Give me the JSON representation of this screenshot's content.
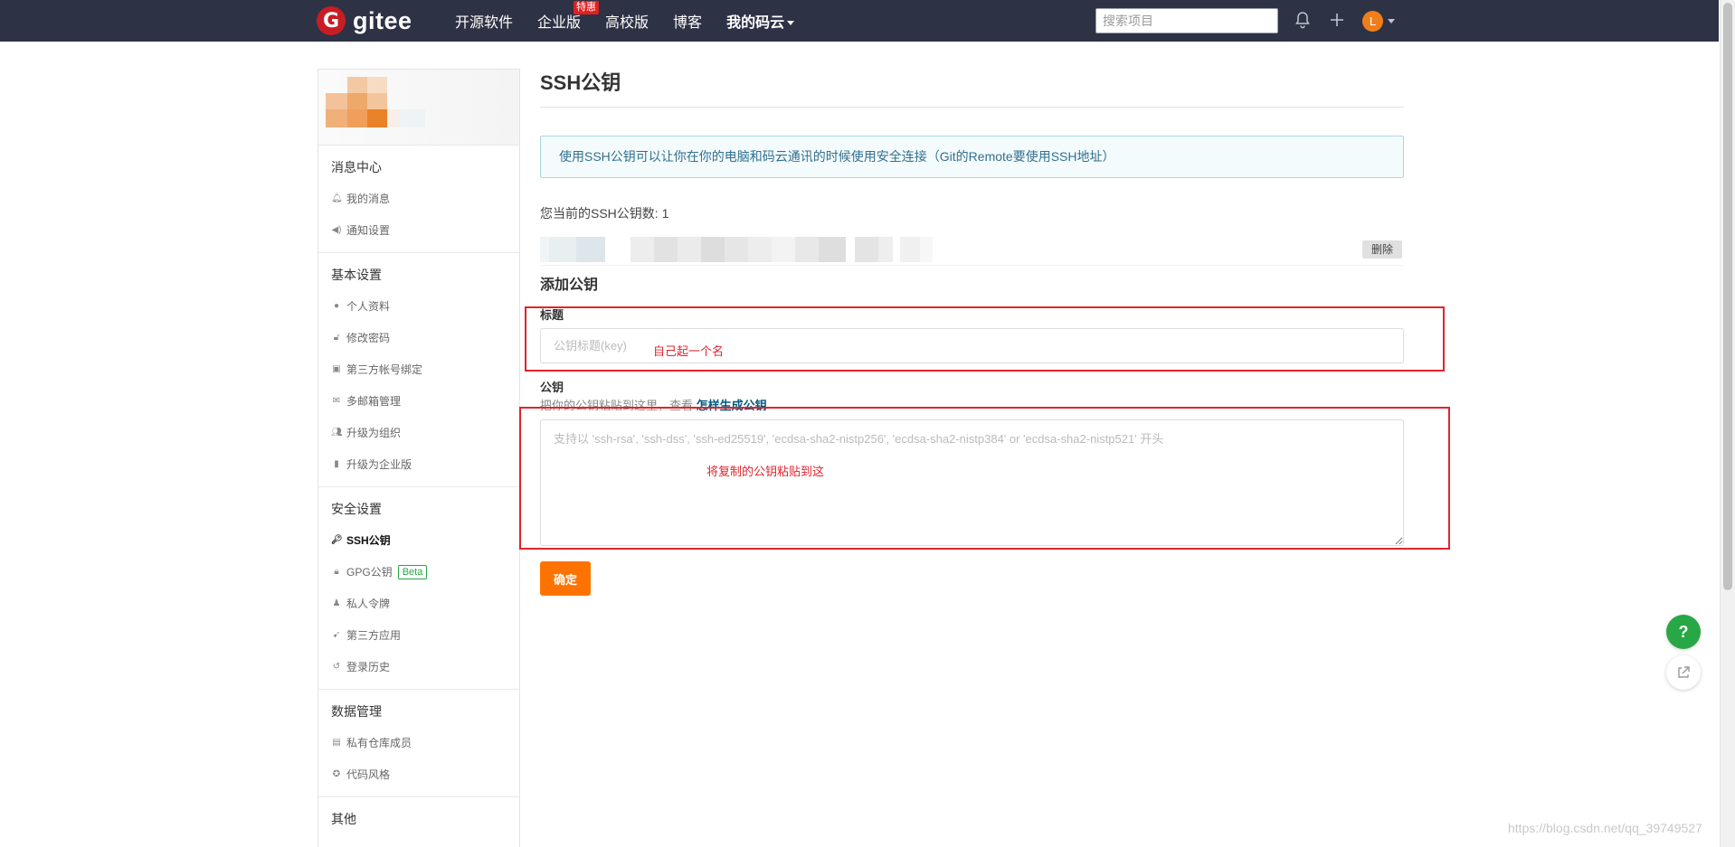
{
  "header": {
    "logo_mark": "G",
    "logo_text": "gitee",
    "nav": [
      {
        "label": "开源软件"
      },
      {
        "label": "企业版",
        "badge": "特惠"
      },
      {
        "label": "高校版"
      },
      {
        "label": "博客"
      },
      {
        "label": "我的码云"
      }
    ],
    "search_placeholder": "搜索项目",
    "avatar_letter": "L"
  },
  "sidebar": {
    "sections": [
      {
        "title": "消息中心",
        "items": [
          {
            "icon": "bell-icon",
            "label": "我的消息"
          },
          {
            "icon": "speaker-icon",
            "label": "通知设置"
          }
        ]
      },
      {
        "title": "基本设置",
        "items": [
          {
            "icon": "user-icon",
            "label": "个人资料"
          },
          {
            "icon": "unlock-icon",
            "label": "修改密码"
          },
          {
            "icon": "id-card-icon",
            "label": "第三方帐号绑定"
          },
          {
            "icon": "mail-icon",
            "label": "多邮箱管理"
          },
          {
            "icon": "users-icon",
            "label": "升级为组织"
          },
          {
            "icon": "building-icon",
            "label": "升级为企业版"
          }
        ]
      },
      {
        "title": "安全设置",
        "items": [
          {
            "icon": "key-icon",
            "label": "SSH公钥",
            "active": true
          },
          {
            "icon": "lock-icon",
            "label": "GPG公钥",
            "badge": "Beta"
          },
          {
            "icon": "token-icon",
            "label": "私人令牌"
          },
          {
            "icon": "rocket-icon",
            "label": "第三方应用"
          },
          {
            "icon": "history-icon",
            "label": "登录历史"
          }
        ]
      },
      {
        "title": "数据管理",
        "items": [
          {
            "icon": "repo-member-icon",
            "label": "私有仓库成员"
          },
          {
            "icon": "palette-icon",
            "label": "代码风格"
          }
        ]
      },
      {
        "title": "其他",
        "items": []
      }
    ]
  },
  "main": {
    "title": "SSH公钥",
    "info": "使用SSH公钥可以让你在你的电脑和码云通讯的时候使用安全连接（Git的Remote要使用SSH地址）",
    "count_text": "您当前的SSH公钥数: 1",
    "delete_label": "删除",
    "add_title": "添加公钥",
    "title_label": "标题",
    "title_placeholder": "公钥标题(key)",
    "key_label": "公钥",
    "key_hint": "把你的公钥粘贴到这里，查看 ",
    "key_hint_link": "怎样生成公钥",
    "key_placeholder": "支持以 'ssh-rsa', 'ssh-dss', 'ssh-ed25519', 'ecdsa-sha2-nistp256', 'ecdsa-sha2-nistp384' or 'ecdsa-sha2-nistp521' 开头",
    "submit_label": "确定"
  },
  "annotations": {
    "title_note": "自己起一个名",
    "key_note": "将复制的公钥粘贴到这",
    "color": "#e0242b"
  },
  "floating": {
    "help_label": "?",
    "share_icon": "external-link-icon"
  },
  "watermark": "https://blog.csdn.net/qq_39749527"
}
